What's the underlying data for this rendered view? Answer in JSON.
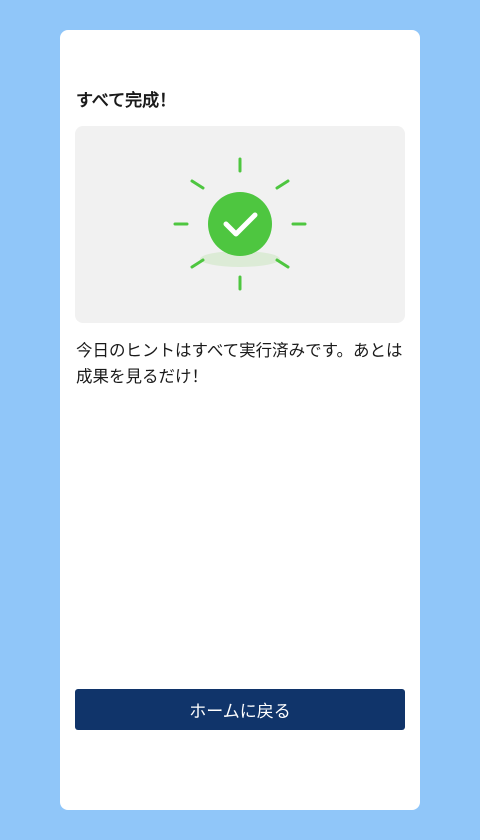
{
  "card": {
    "title": "すべて完成！",
    "message": "今日のヒントはすべて実行済みです。あとは成果を見るだけ！",
    "home_button_label": "ホームに戻る"
  },
  "illustration": {
    "icon": "sun-checkmark-icon",
    "badge_color": "#4ec640",
    "ray_color": "#4ec640",
    "shadow_color": "#dcebd6",
    "background_color": "#f1f1f1"
  },
  "colors": {
    "page_background": "#90c6f9",
    "card_background": "#ffffff",
    "button_background": "#10346a",
    "button_text": "#ffffff"
  }
}
